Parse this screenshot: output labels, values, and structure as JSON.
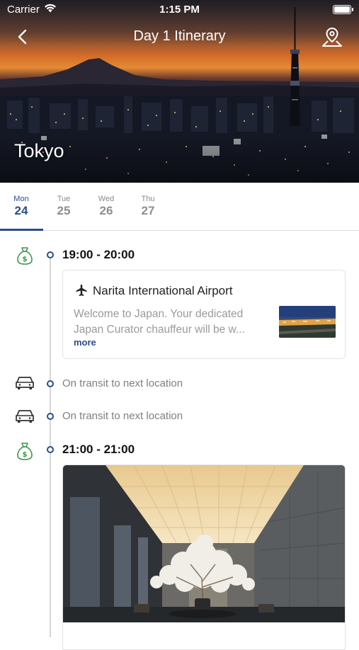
{
  "status_bar": {
    "carrier": "Carrier",
    "time": "1:15 PM"
  },
  "nav": {
    "title": "Day 1 Itinerary",
    "back_icon": "chevron-left-icon",
    "map_icon": "map-pin-icon"
  },
  "hero": {
    "city": "Tokyo"
  },
  "days": [
    {
      "dow": "Mon",
      "num": "24",
      "active": true
    },
    {
      "dow": "Tue",
      "num": "25",
      "active": false
    },
    {
      "dow": "Wed",
      "num": "26",
      "active": false
    },
    {
      "dow": "Thu",
      "num": "27",
      "active": false
    }
  ],
  "timeline": {
    "event1": {
      "time": "19:00 - 20:00",
      "icon": "money-bag-icon",
      "place": "Narita International Airport",
      "place_icon": "plane-icon",
      "description": "Welcome to Japan. Your dedicated Japan Curator chauffeur will be w...",
      "more": "more"
    },
    "transit1": {
      "text": "On transit to next location",
      "icon": "car-icon"
    },
    "transit2": {
      "text": "On transit to next location",
      "icon": "car-icon"
    },
    "event2": {
      "time": "21:00 - 21:00",
      "icon": "money-bag-icon"
    }
  },
  "colors": {
    "accent": "#2a4c8c",
    "green_icon": "#3a9a4a"
  }
}
